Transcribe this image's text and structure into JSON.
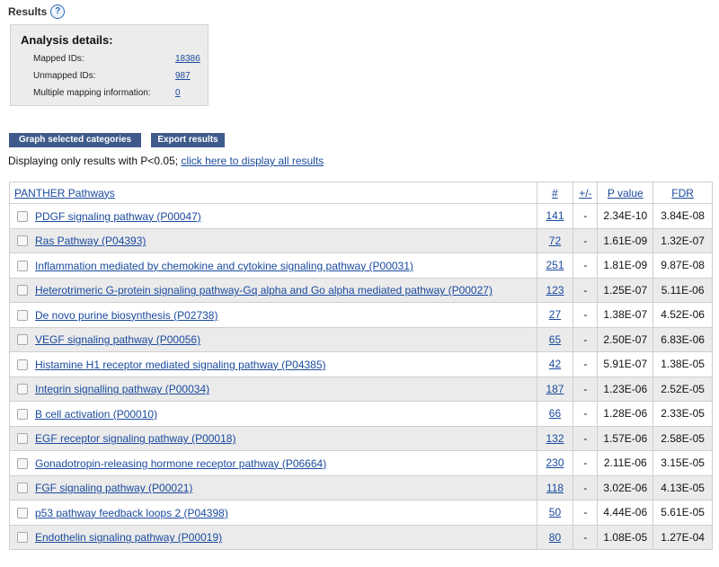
{
  "header": {
    "title": "Results",
    "help_glyph": "?"
  },
  "analysis": {
    "heading": "Analysis details:",
    "mapped_label": "Mapped IDs:",
    "mapped_value": "18386",
    "unmapped_label": "Unmapped IDs:",
    "unmapped_value": "987",
    "multi_label": "Multiple mapping information:",
    "multi_value": "0"
  },
  "toolbar": {
    "graph_label": "Graph selected categories",
    "export_label": "Export results"
  },
  "filter": {
    "prefix": "Displaying only results with P<0.05; ",
    "link": "click here to display all results"
  },
  "table": {
    "headers": {
      "pathway": "PANTHER Pathways",
      "count": "#",
      "dir": "+/-",
      "pvalue": "P value",
      "fdr": "FDR"
    },
    "rows": [
      {
        "name": "PDGF signaling pathway (P00047)",
        "count": "141",
        "dir": "-",
        "pvalue": "2.34E-10",
        "fdr": "3.84E-08"
      },
      {
        "name": "Ras Pathway (P04393)",
        "count": "72",
        "dir": "-",
        "pvalue": "1.61E-09",
        "fdr": "1.32E-07"
      },
      {
        "name": "Inflammation mediated by chemokine and cytokine signaling pathway (P00031)",
        "count": "251",
        "dir": "-",
        "pvalue": "1.81E-09",
        "fdr": "9.87E-08"
      },
      {
        "name": "Heterotrimeric G-protein signaling pathway-Gq alpha and Go alpha mediated pathway (P00027)",
        "count": "123",
        "dir": "-",
        "pvalue": "1.25E-07",
        "fdr": "5.11E-06"
      },
      {
        "name": "De novo purine biosynthesis (P02738)",
        "count": "27",
        "dir": "-",
        "pvalue": "1.38E-07",
        "fdr": "4.52E-06"
      },
      {
        "name": "VEGF signaling pathway (P00056)",
        "count": "65",
        "dir": "-",
        "pvalue": "2.50E-07",
        "fdr": "6.83E-06"
      },
      {
        "name": "Histamine H1 receptor mediated signaling pathway (P04385)",
        "count": "42",
        "dir": "-",
        "pvalue": "5.91E-07",
        "fdr": "1.38E-05"
      },
      {
        "name": "Integrin signalling pathway (P00034)",
        "count": "187",
        "dir": "-",
        "pvalue": "1.23E-06",
        "fdr": "2.52E-05"
      },
      {
        "name": "B cell activation (P00010)",
        "count": "66",
        "dir": "-",
        "pvalue": "1.28E-06",
        "fdr": "2.33E-05"
      },
      {
        "name": "EGF receptor signaling pathway (P00018)",
        "count": "132",
        "dir": "-",
        "pvalue": "1.57E-06",
        "fdr": "2.58E-05"
      },
      {
        "name": "Gonadotropin-releasing hormone receptor pathway (P06664)",
        "count": "230",
        "dir": "-",
        "pvalue": "2.11E-06",
        "fdr": "3.15E-05"
      },
      {
        "name": "FGF signaling pathway (P00021)",
        "count": "118",
        "dir": "-",
        "pvalue": "3.02E-06",
        "fdr": "4.13E-05"
      },
      {
        "name": "p53 pathway feedback loops 2 (P04398)",
        "count": "50",
        "dir": "-",
        "pvalue": "4.44E-06",
        "fdr": "5.61E-05"
      },
      {
        "name": "Endothelin signaling pathway (P00019)",
        "count": "80",
        "dir": "-",
        "pvalue": "1.08E-05",
        "fdr": "1.27E-04"
      }
    ]
  },
  "colors": {
    "link": "#1a4a9e",
    "button": "#3f5b8b",
    "row_alt": "#ebebeb"
  }
}
